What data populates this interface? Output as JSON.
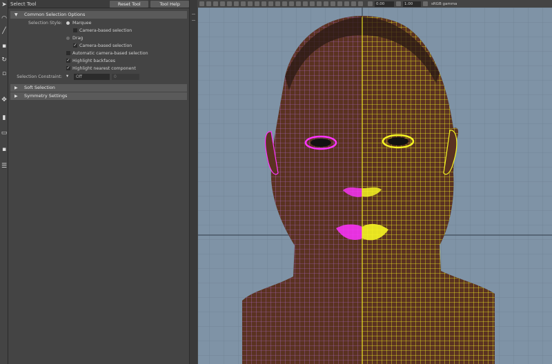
{
  "tool_settings": {
    "title": "Select Tool",
    "reset_label": "Reset Tool",
    "help_label": "Tool Help"
  },
  "common_selection": {
    "header": "Common Selection Options",
    "selection_style_label": "Selection Style:",
    "marquee_label": "Marquee",
    "camera_based_1": "Camera-based selection",
    "drag_label": "Drag",
    "camera_based_2": "Camera-based selection",
    "auto_camera_based": "Automatic camera-based selection",
    "highlight_backfaces": "Highlight backfaces",
    "highlight_nearest": "Highlight nearest component",
    "selection_constraint_label": "Selection Constraint:",
    "constraint_value": "Off",
    "constraint_extra": "0"
  },
  "sections": {
    "soft_selection": "Soft Selection",
    "symmetry_settings": "Symmetry Settings"
  },
  "viewport": {
    "exposure": "0.00",
    "gamma": "1.00",
    "color_space": "sRGB gamma",
    "colors": {
      "background": "#7f93a6",
      "skin": "#5a3221",
      "wire_left": "#c77dff",
      "wire_right": "#f5f522",
      "sym_highlight": "#ff33ff"
    }
  }
}
